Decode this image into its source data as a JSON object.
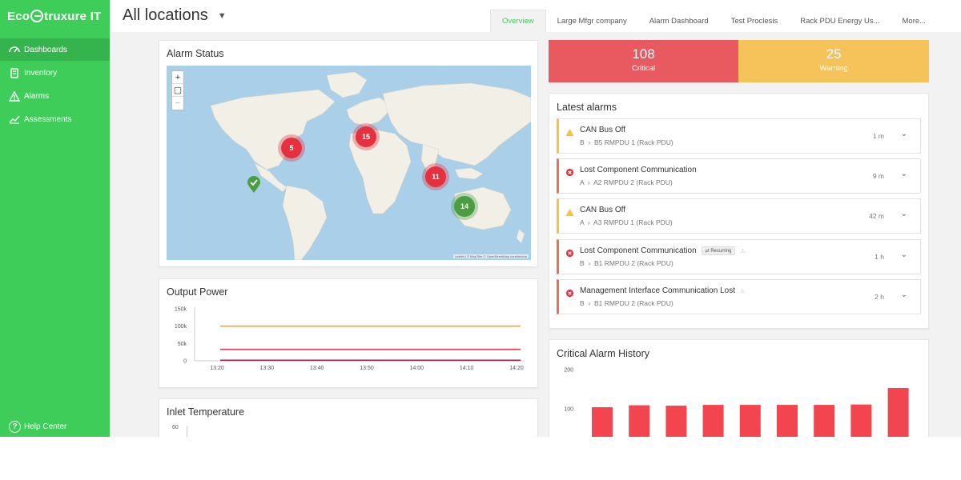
{
  "app": {
    "logo_text_left": "Eco",
    "logo_text_right": "truxure IT"
  },
  "sidebar": {
    "items": [
      {
        "label": "Dashboards",
        "icon": "dashboard-icon",
        "active": true
      },
      {
        "label": "Inventory",
        "icon": "inventory-icon",
        "active": false
      },
      {
        "label": "Alarms",
        "icon": "alarm-icon",
        "active": false
      },
      {
        "label": "Assessments",
        "icon": "assessment-icon",
        "active": false
      }
    ],
    "help_label": "Help Center"
  },
  "header": {
    "location": "All locations",
    "tabs": [
      "Overview",
      "Large Mfgr company",
      "Alarm Dashboard",
      "Test Proclesis",
      "Rack PDU Energy Us...",
      "More..."
    ],
    "active_tab": "Overview"
  },
  "alarm_status": {
    "title": "Alarm Status",
    "zoom_in": "+",
    "zoom_out": "−",
    "attribution": "Leaflet | © MapTiler © OpenStreetMap contributors",
    "clusters": [
      {
        "count": "5",
        "color": "red"
      },
      {
        "count": "15",
        "color": "red"
      },
      {
        "count": "11",
        "color": "red"
      },
      {
        "count": "14",
        "color": "green"
      }
    ]
  },
  "summary": {
    "critical": {
      "value": "108",
      "label": "Critical",
      "color": "#e85a5f"
    },
    "warning": {
      "value": "25",
      "label": "Warning",
      "color": "#f6c25a"
    }
  },
  "latest_alarms": {
    "title": "Latest alarms",
    "items": [
      {
        "severity": "warning",
        "title": "CAN Bus Off",
        "loc": "B",
        "device": "B5 RMPDU 1 (Rack PDU)",
        "time": "1 m",
        "recurring": false
      },
      {
        "severity": "critical",
        "title": "Lost Component Communication",
        "loc": "A",
        "device": "A2 RMPDU 2 (Rack PDU)",
        "time": "9 m",
        "recurring": false
      },
      {
        "severity": "warning",
        "title": "CAN Bus Off",
        "loc": "A",
        "device": "A3 RMPDU 1 (Rack PDU)",
        "time": "42 m",
        "recurring": false
      },
      {
        "severity": "critical",
        "title": "Lost Component Communication",
        "loc": "B",
        "device": "B1 RMPDU 2 (Rack PDU)",
        "time": "1 h",
        "recurring": true,
        "recurring_label": "Recurring"
      },
      {
        "severity": "critical",
        "title": "Management Interface Communication Lost",
        "loc": "B",
        "device": "B1 RMPDU 2 (Rack PDU)",
        "time": "2 h",
        "recurring": false
      }
    ]
  },
  "output_power": {
    "title": "Output Power",
    "chart_data": {
      "type": "line",
      "x": [
        "13:20",
        "13:30",
        "13:40",
        "13:50",
        "14:00",
        "14:10",
        "14:20"
      ],
      "y_ticks": [
        "150k",
        "100k",
        "50k",
        "0"
      ],
      "ylim": [
        0,
        150000
      ],
      "series": [
        {
          "color": "#f5a623",
          "values": [
            100000,
            100000,
            100000,
            100000,
            100000,
            100000,
            100000
          ]
        },
        {
          "color": "#e03a50",
          "values": [
            33000,
            33000,
            33000,
            33000,
            33000,
            33000,
            33000
          ]
        },
        {
          "color": "#a0214a",
          "values": [
            1500,
            1500,
            1500,
            1500,
            1500,
            1500,
            1500
          ]
        }
      ]
    }
  },
  "inlet_temperature": {
    "title": "Inlet Temperature",
    "chart_data": {
      "type": "line",
      "y_ticks": [
        "60"
      ]
    }
  },
  "critical_history": {
    "title": "Critical Alarm History",
    "chart_data": {
      "type": "bar",
      "y_ticks": [
        "200",
        "100"
      ],
      "ylim": [
        0,
        200
      ],
      "values": [
        104,
        109,
        108,
        110,
        110,
        110,
        110,
        111,
        153
      ],
      "color": "#f2454f"
    }
  }
}
